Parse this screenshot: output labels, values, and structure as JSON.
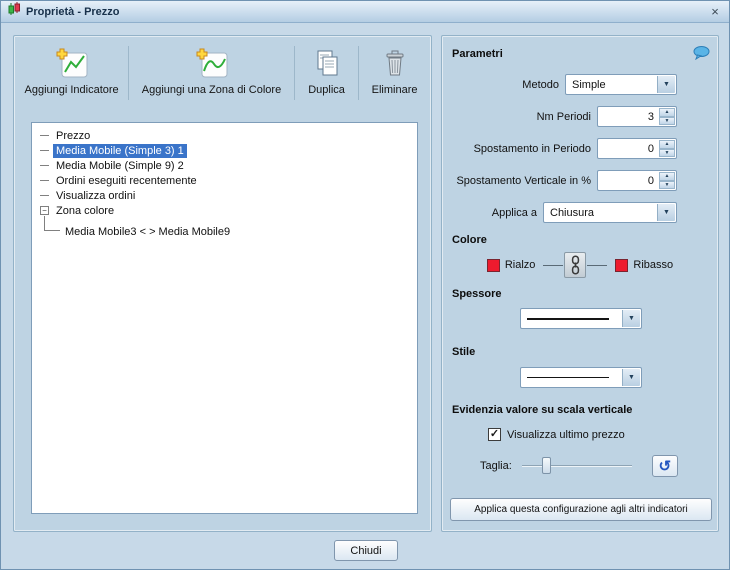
{
  "window": {
    "title": "Proprietà - Prezzo"
  },
  "icons": {
    "close": "×",
    "dropdown_arrow": "▼",
    "spin_up": "▲",
    "spin_down": "▼",
    "check": "✓",
    "reset": "↺",
    "tree_collapse": "−"
  },
  "toolbar": {
    "add_indicator_label": "Aggiungi Indicatore",
    "add_color_zone_label": "Aggiungi una Zona di Colore",
    "duplicate_label": "Duplica",
    "delete_label": "Eliminare"
  },
  "tree": {
    "items": [
      {
        "label": "Prezzo",
        "selected": false
      },
      {
        "label": "Media Mobile (Simple 3) 1",
        "selected": true
      },
      {
        "label": "Media Mobile (Simple 9) 2",
        "selected": false
      },
      {
        "label": "Ordini eseguiti recentemente",
        "selected": false
      },
      {
        "label": "Visualizza ordini",
        "selected": false
      },
      {
        "label": "Zona colore",
        "selected": false
      },
      {
        "label": "Media Mobile3 < > Media Mobile9",
        "selected": false
      }
    ]
  },
  "parameters": {
    "section_title": "Parametri",
    "metodo": {
      "label": "Metodo",
      "value": "Simple"
    },
    "nm_periodi": {
      "label": "Nm Periodi",
      "value": "3"
    },
    "spostamento_periodo": {
      "label": "Spostamento in Periodo",
      "value": "0"
    },
    "spostamento_verticale": {
      "label": "Spostamento Verticale in %",
      "value": "0"
    },
    "applica_a": {
      "label": "Applica a",
      "value": "Chiusura"
    }
  },
  "colore": {
    "section_title": "Colore",
    "rialzo_label": "Rialzo",
    "ribasso_label": "Ribasso",
    "rialzo_color": "#ed1b2e",
    "ribasso_color": "#ed1b2e"
  },
  "spessore": {
    "section_title": "Spessore"
  },
  "stile": {
    "section_title": "Stile"
  },
  "evidenzia": {
    "section_title": "Evidenzia valore su scala verticale",
    "checkbox_label": "Visualizza ultimo prezzo",
    "checked": true,
    "taglia_label": "Taglia:",
    "taglia_position_pct": 18
  },
  "apply_all_label": "Applica questa configurazione agli altri indicatori",
  "footer": {
    "close_label": "Chiudi"
  }
}
